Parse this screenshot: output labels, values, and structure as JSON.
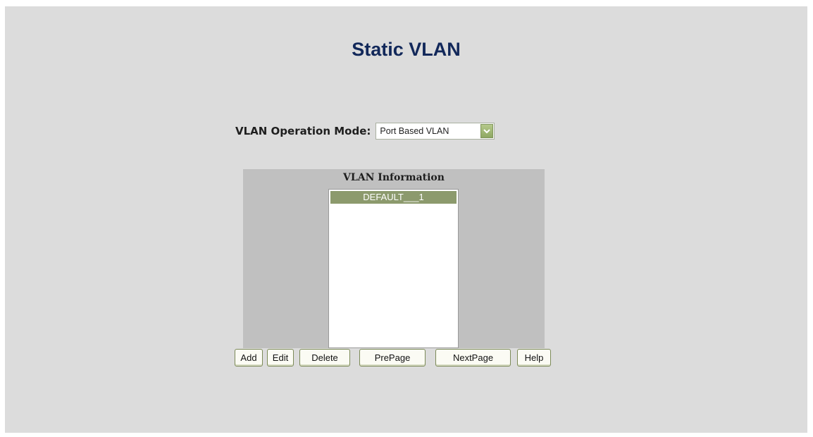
{
  "page": {
    "title": "Static VLAN"
  },
  "operation_mode": {
    "label": "VLAN Operation Mode:",
    "selected": "Port Based VLAN"
  },
  "vlan_info": {
    "title": "VLAN Information",
    "items": [
      "DEFAULT___1"
    ],
    "selected_index": 0
  },
  "buttons": {
    "add": "Add",
    "edit": "Edit",
    "delete": "Delete",
    "prepage": "PrePage",
    "nextpage": "NextPage",
    "help": "Help"
  },
  "colors": {
    "title": "#12285a",
    "selection": "#8c9a6d",
    "background": "#dcdcdc",
    "panel": "#c0c0c0"
  },
  "icons": {
    "select_arrow": "chevron-down-icon"
  }
}
